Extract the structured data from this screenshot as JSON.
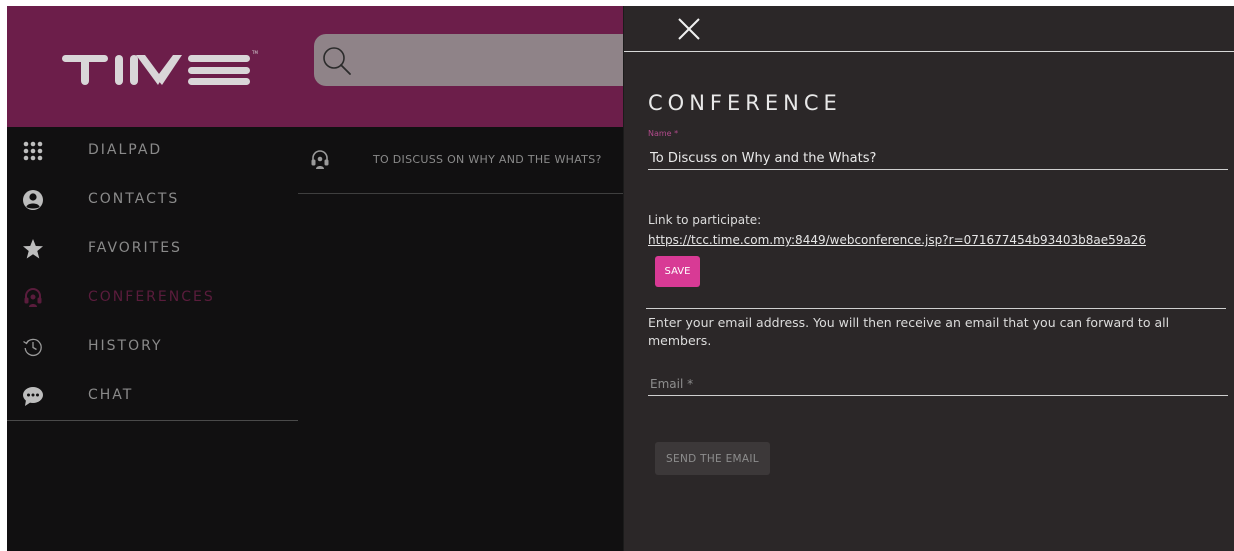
{
  "header": {
    "logo_text": "TIME",
    "search_placeholder": ""
  },
  "sidebar": {
    "items": [
      {
        "label": "DIALPAD",
        "icon": "dialpad-icon",
        "active": false
      },
      {
        "label": "CONTACTS",
        "icon": "contact-icon",
        "active": false
      },
      {
        "label": "FAVORITES",
        "icon": "star-icon",
        "active": false
      },
      {
        "label": "CONFERENCES",
        "icon": "headset-icon",
        "active": true
      },
      {
        "label": "HISTORY",
        "icon": "history-icon",
        "active": false
      },
      {
        "label": "CHAT",
        "icon": "chat-bubble-icon",
        "active": false
      }
    ]
  },
  "conference_list": {
    "items": [
      {
        "label": "TO DISCUSS ON WHY AND THE WHATS?",
        "icon": "headset-icon"
      }
    ]
  },
  "panel": {
    "close_icon": "close-icon",
    "title": "CONFERENCE",
    "name_label": "Name *",
    "name_value": "To Discuss on Why and the Whats?",
    "link_label": "Link to participate:",
    "link_url": "https://tcc.time.com.my:8449/webconference.jsp?r=071677454b93403b8ae59a26",
    "save_label": "SAVE",
    "info_text": "Enter your email address. You will then receive an email that you can forward to all members.",
    "email_placeholder": "Email *",
    "send_label": "SEND THE EMAIL"
  },
  "colors": {
    "header_bg": "#6c1e4a",
    "accent": "#d83a95",
    "active_nav": "#5a1c3c",
    "panel_bg": "#2b2728",
    "sidebar_bg": "#111011"
  }
}
